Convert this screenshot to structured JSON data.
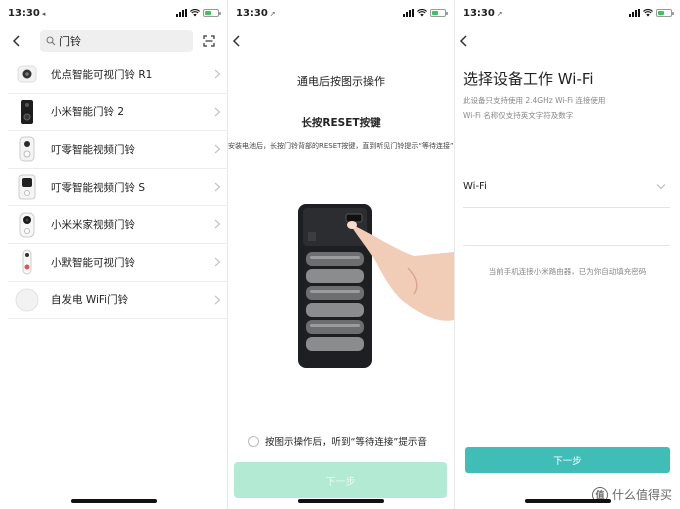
{
  "status_bars": [
    {
      "time": "13:30",
      "location_arrow": "◂"
    },
    {
      "time": "13:30",
      "location_arrow": "➚"
    },
    {
      "time": "13:30",
      "location_arrow": "➚"
    }
  ],
  "screen1": {
    "search": {
      "value": "门铃"
    },
    "devices": [
      {
        "label": "优点智能可视门铃 R1",
        "icon": "doorbell-round-icon"
      },
      {
        "label": "小米智能门铃 2",
        "icon": "doorbell-black-icon"
      },
      {
        "label": "叮零智能视频门铃",
        "icon": "doorbell-white-icon"
      },
      {
        "label": "叮零智能视频门铃 S",
        "icon": "doorbell-square-icon"
      },
      {
        "label": "小米米家视频门铃",
        "icon": "doorbell-camera-icon"
      },
      {
        "label": "小默智能可视门铃",
        "icon": "doorbell-slim-icon"
      },
      {
        "label": "自发电 WiFi门铃",
        "icon": "doorbell-disc-icon"
      }
    ]
  },
  "screen2": {
    "title": "通电后按图示操作",
    "subtitle": "长按RESET按键",
    "description": "安装电池后，长按门铃背部的RESET按键，直到听见门铃提示“等待连接”",
    "checkbox_label": "按图示操作后，听到“等待连接”提示音",
    "next_label": "下一步"
  },
  "screen3": {
    "title": "选择设备工作 Wi-Fi",
    "desc_line1": "此设备只支持使用 2.4GHz Wi-Fi 连接使用",
    "desc_line2": "Wi-Fi 名称仅支持英文字符及数字",
    "wifi_label": "Wi-Fi",
    "note": "当前手机连接小米路由器，已为你自动填充密码",
    "next_label": "下一步"
  },
  "watermark": {
    "text": "什么值得买",
    "badge": "值"
  },
  "colors": {
    "primary": "#3fbdb6",
    "disabled": "#b3ead3",
    "battery": "#35c759"
  }
}
